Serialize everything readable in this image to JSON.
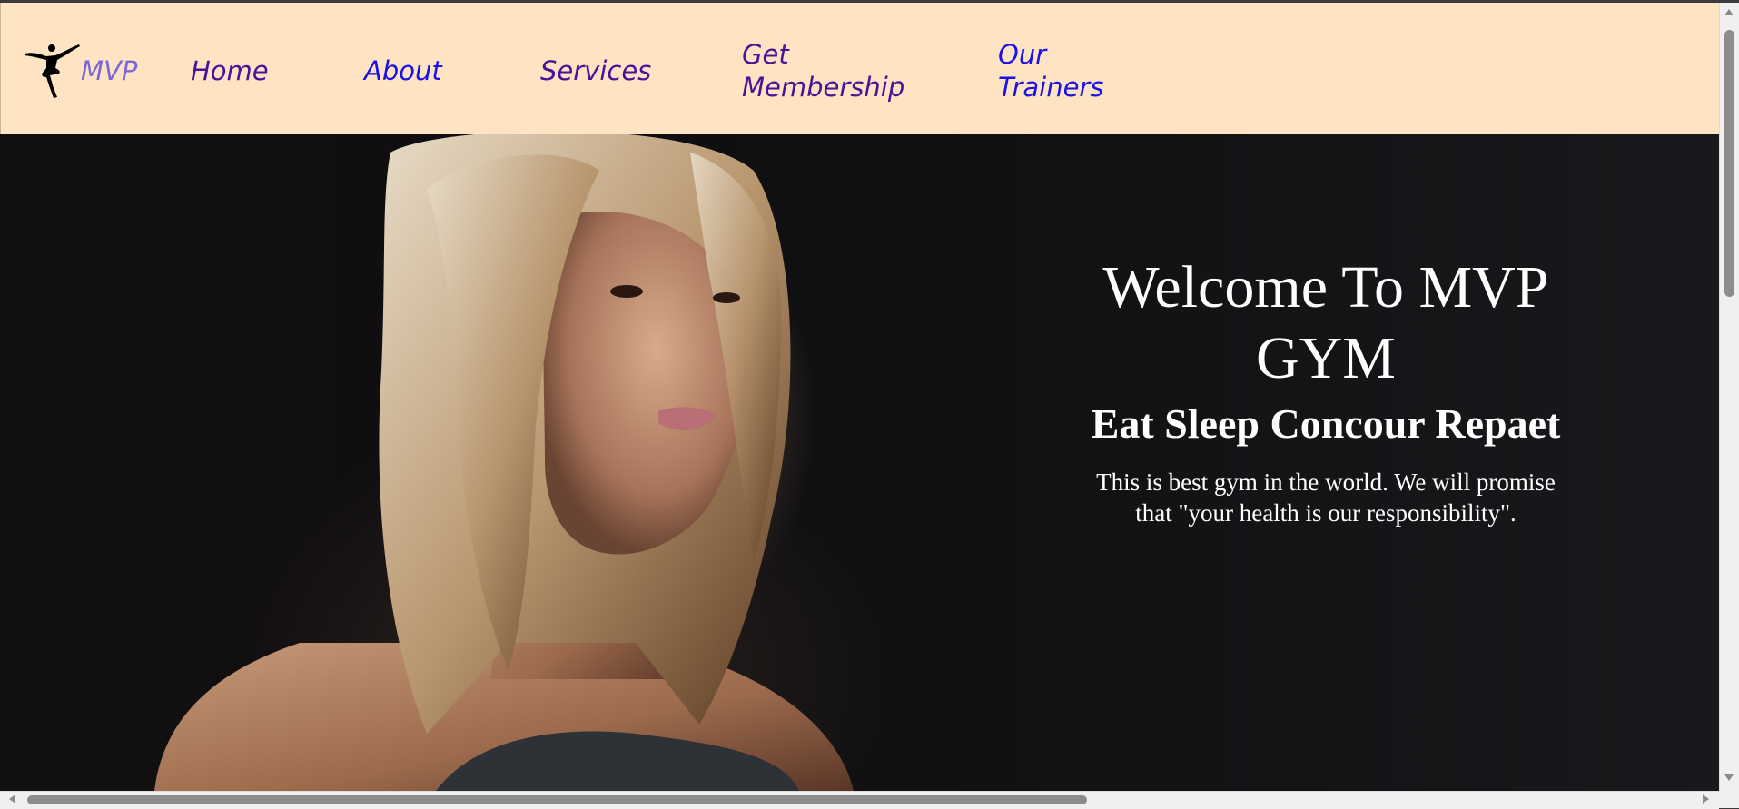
{
  "nav": {
    "brand": "MVP",
    "logo_icon": "ballerina-silhouette-icon",
    "links": {
      "home": "Home",
      "about": "About",
      "services": "Services",
      "membership_line1": "Get",
      "membership_line2": "Membership",
      "trainers_line1": "Our",
      "trainers_line2": "Trainers"
    }
  },
  "hero": {
    "title_line1": "Welcome To MVP",
    "title_line2": "GYM",
    "subtitle": "Eat Sleep Concour Repaet",
    "desc_line1": "This is best gym in the world. We will promise",
    "desc_line2": "that \"your health is our responsibility\"."
  },
  "colors": {
    "nav_background": "#ffe4c4",
    "link_visited": "#4b1297",
    "link_unvisited": "#1a12e6",
    "brand_link": "#7a68d6",
    "hero_text": "#ffffff"
  }
}
